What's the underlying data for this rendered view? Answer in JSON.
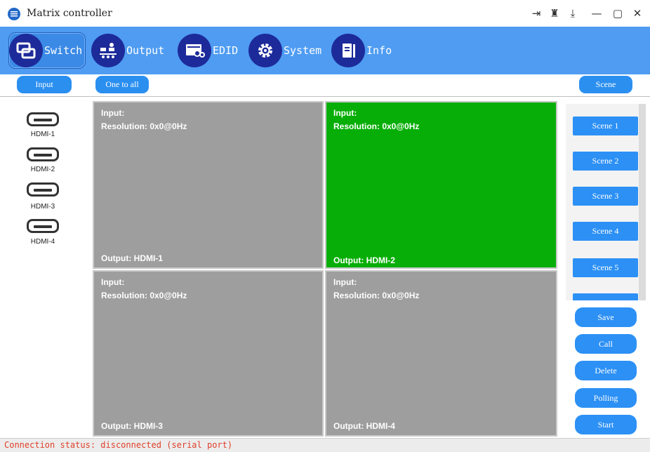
{
  "window": {
    "title": "Matrix controller",
    "controls": {
      "logout": "⇥",
      "pin": "♜",
      "download": "⤓",
      "minimize": "—",
      "maximize": "▢",
      "close": "✕"
    }
  },
  "toolbar": {
    "tabs": [
      {
        "label": "Switch",
        "icon": "switch-icon",
        "active": true
      },
      {
        "label": "Output",
        "icon": "output-icon",
        "active": false
      },
      {
        "label": "EDID",
        "icon": "edid-icon",
        "active": false
      },
      {
        "label": "System",
        "icon": "gear-icon",
        "active": false
      },
      {
        "label": "Info",
        "icon": "info-icon",
        "active": false
      }
    ],
    "colors": {
      "bar": "#4f9cf2",
      "icon_bg": "#1d2a9a"
    }
  },
  "controls": {
    "input_label": "Input",
    "one_to_all_label": "One to all",
    "scene_label": "Scene"
  },
  "inputs": [
    {
      "label": "HDMI-1"
    },
    {
      "label": "HDMI-2"
    },
    {
      "label": "HDMI-3"
    },
    {
      "label": "HDMI-4"
    }
  ],
  "outputs": [
    {
      "input": "Input:",
      "resolution": "Resolution: 0x0@0Hz",
      "output": "Output: HDMI-1",
      "active": false
    },
    {
      "input": "Input:",
      "resolution": "Resolution: 0x0@0Hz",
      "output": "Output: HDMI-2",
      "active": true
    },
    {
      "input": "Input:",
      "resolution": "Resolution: 0x0@0Hz",
      "output": "Output: HDMI-3",
      "active": false
    },
    {
      "input": "Input:",
      "resolution": "Resolution: 0x0@0Hz",
      "output": "Output: HDMI-4",
      "active": false
    }
  ],
  "scenes": [
    "Scene 1",
    "Scene 2",
    "Scene 3",
    "Scene 4",
    "Scene 5"
  ],
  "actions": {
    "save": "Save",
    "call": "Call",
    "delete": "Delete",
    "polling": "Polling",
    "start": "Start"
  },
  "status": {
    "text": "Connection status: disconnected (serial port)",
    "color": "#e0402a"
  },
  "colors": {
    "accent": "#2c90f5",
    "tile_inactive": "#9e9e9e",
    "tile_active": "#08ae08"
  }
}
